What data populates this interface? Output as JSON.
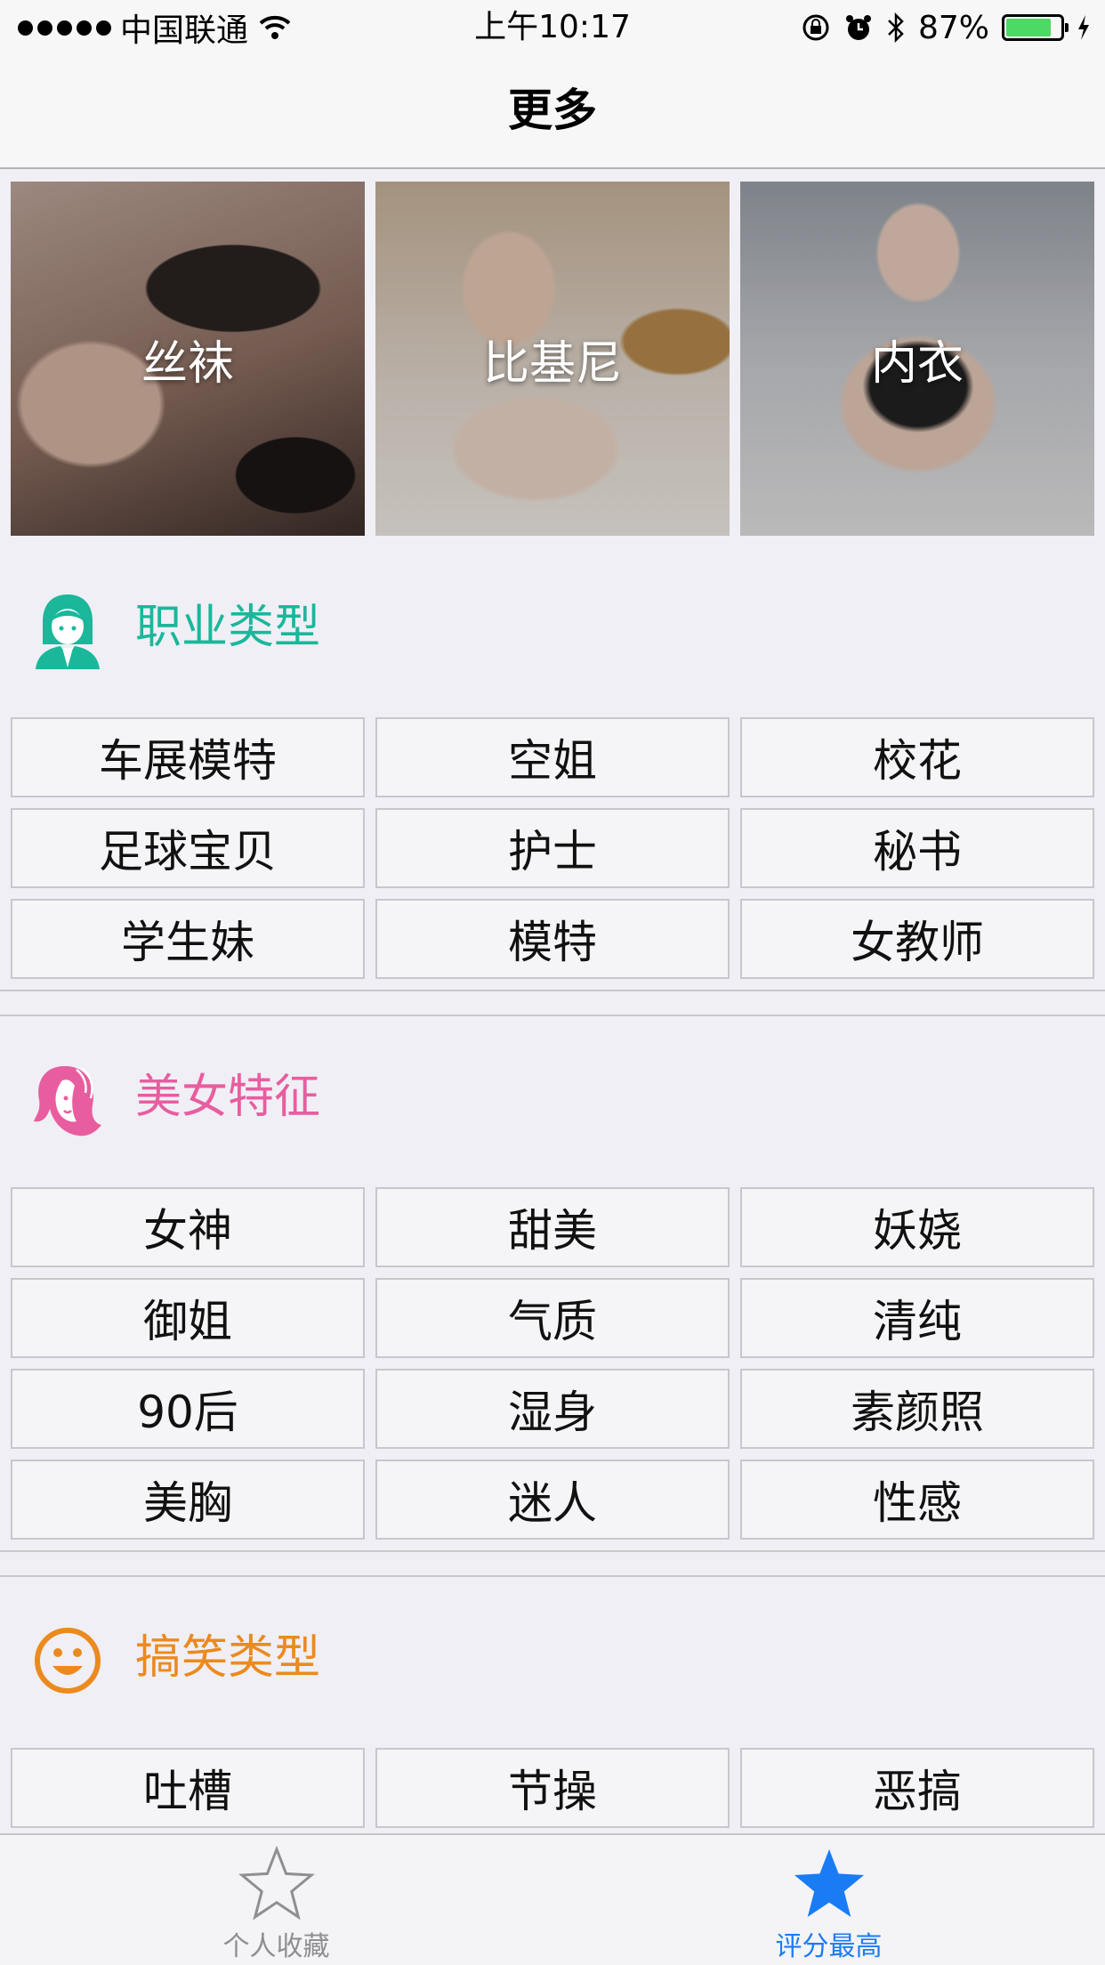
{
  "status_bar": {
    "carrier": "中国联通",
    "time": "上午10:17",
    "battery": "87%",
    "battery_level": 0.87
  },
  "nav": {
    "title": "更多"
  },
  "featured": [
    {
      "label": "丝袜"
    },
    {
      "label": "比基尼"
    },
    {
      "label": "内衣"
    }
  ],
  "sections": [
    {
      "title": "职业类型",
      "color": "#1ab79b",
      "icon": "woman-icon",
      "tags": [
        "车展模特",
        "空姐",
        "校花",
        "足球宝贝",
        "护士",
        "秘书",
        "学生妹",
        "模特",
        "女教师"
      ]
    },
    {
      "title": "美女特征",
      "color": "#e85d9f",
      "icon": "woman-face-icon",
      "tags": [
        "女神",
        "甜美",
        "妖娆",
        "御姐",
        "气质",
        "清纯",
        "90后",
        "湿身",
        "素颜照",
        "美胸",
        "迷人",
        "性感"
      ]
    },
    {
      "title": "搞笑类型",
      "color": "#eb8a1f",
      "icon": "smiley-icon",
      "tags": [
        "吐槽",
        "节操",
        "恶搞"
      ]
    }
  ],
  "tab_bar": {
    "tabs": [
      {
        "label": "个人收藏",
        "icon": "star-outline-icon",
        "color": "#8e8e93"
      },
      {
        "label": "评分最高",
        "icon": "star-filled-icon",
        "color": "#1a7cf5"
      }
    ]
  }
}
